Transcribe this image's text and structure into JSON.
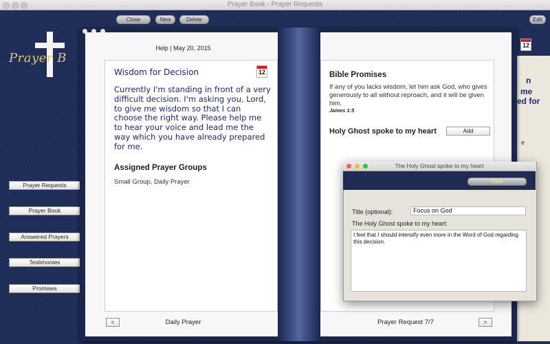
{
  "window": {
    "title": "Prayer Book - Prayer Requests"
  },
  "toolbar": {
    "close_label": "Close",
    "new_label": "New",
    "delete_label": "Delete",
    "edit_label": "Edit"
  },
  "logo": {
    "text": "Prayer B"
  },
  "sidebar": {
    "items": [
      {
        "label": "Prayer Requests"
      },
      {
        "label": "Prayer Book"
      },
      {
        "label": "Answered Prayers"
      },
      {
        "label": "Testimonies"
      },
      {
        "label": "Promises"
      }
    ]
  },
  "left_page": {
    "header": "Help | May 20, 2015",
    "prayer_title": "Wisdom for Decision",
    "calendar_day": "12",
    "prayer_body": "Currently I'm standing in front of a very difficult decision. I'm asking you, Lord, to give me wisdom so that I can choose the right way. Please help me to hear your voice and lead me the way which you have already prepared for me.",
    "groups_heading": "Assigned Prayer Groups",
    "groups_value": "Small Group, Daily Prayer",
    "prev_label": "<",
    "footer": "Daily Prayer"
  },
  "right_page": {
    "bible_heading": "Bible Promises",
    "bible_text": "If any of you lacks wisdom, let him ask God, who gives generously to all without reproach, and it will be given him.",
    "bible_ref": "James 1:5",
    "holy_ghost_heading": "Holy Ghost spoke to my heart",
    "add_label": "Add",
    "footer": "Prayer Request 7/7",
    "next_label": ">"
  },
  "background_window": {
    "calendar_day": "12",
    "peek_lines": [
      "n",
      "me",
      "ed for",
      "e"
    ]
  },
  "dialog": {
    "title": "The Holy Ghost spoke to my heart",
    "save_label": "Save",
    "title_label": "Title (optional):",
    "title_value": "Focus on God",
    "spoke_label": "The Holy Ghost spoke to my heart:",
    "spoke_value": "I feel that I should intensify even more in the Word of God regarding this decision."
  },
  "colors": {
    "navy": "#1f2d56",
    "prayer_ink": "#1c2674",
    "logo_gold": "#e3c768"
  }
}
